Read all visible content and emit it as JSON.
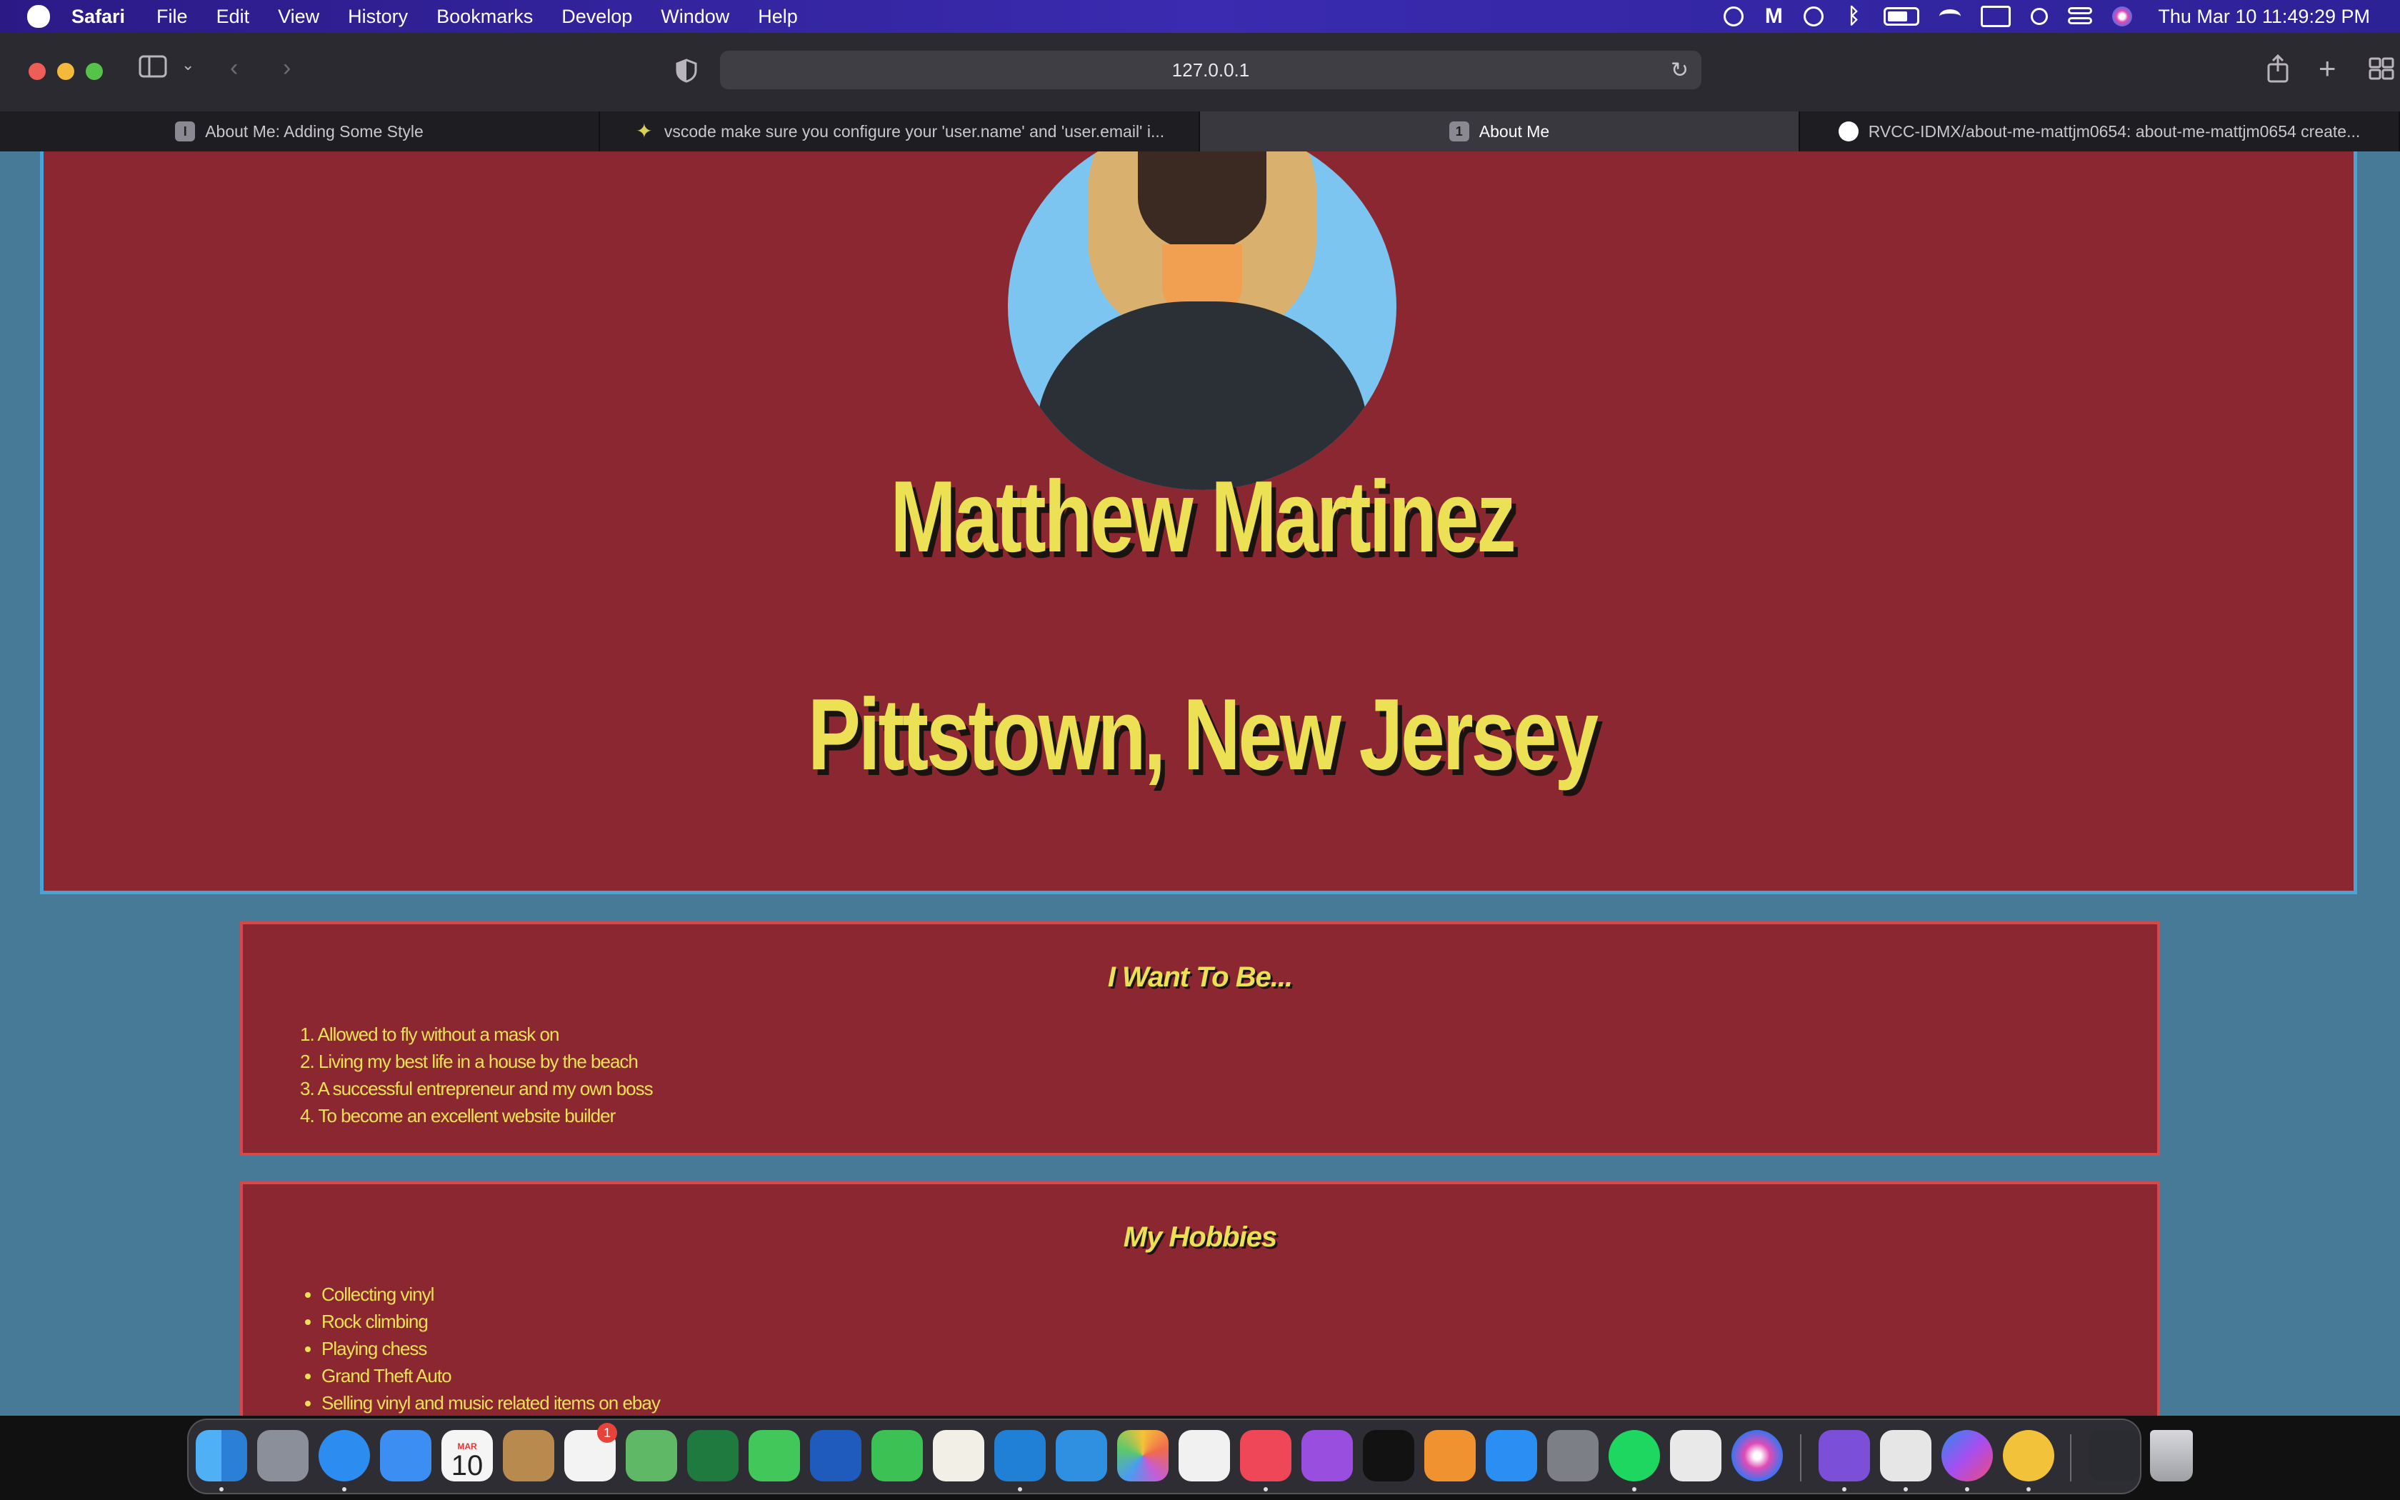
{
  "menubar": {
    "app_name": "Safari",
    "items": [
      "File",
      "Edit",
      "View",
      "History",
      "Bookmarks",
      "Develop",
      "Window",
      "Help"
    ],
    "clock": "Thu Mar 10  11:49:29 PM"
  },
  "toolbar": {
    "url": "127.0.0.1"
  },
  "tabs": [
    {
      "label": "About Me: Adding Some Style",
      "favicon": "I"
    },
    {
      "label": "vscode make sure you configure your 'user.name' and 'user.email' i...",
      "favicon": "wand-icon"
    },
    {
      "label": "About Me",
      "favicon": "1",
      "active": true
    },
    {
      "label": "RVCC-IDMX/about-me-mattjm0654: about-me-mattjm0654 create...",
      "favicon": "github-icon"
    }
  ],
  "page": {
    "name": "Matthew Martinez",
    "city": "Pittstown, New Jersey",
    "want_section": {
      "title": "I Want To Be...",
      "items": [
        "1. Allowed to fly without a mask on",
        "2. Living my best life in a house by the beach",
        "3. A successful entrepreneur and my own boss",
        "4. To become an excellent website builder"
      ]
    },
    "hobbies_section": {
      "title": "My Hobbies",
      "items": [
        "Collecting vinyl",
        "Rock climbing",
        "Playing chess",
        "Grand Theft Auto",
        "Selling vinyl and music related items on ebay"
      ]
    }
  },
  "dock": {
    "calendar_month": "MAR",
    "calendar_day": "10",
    "reminders_badge": "1"
  },
  "colors": {
    "page_background": "#477a96",
    "card_background": "#8a2730",
    "heading_text": "#ece055",
    "card_border": "#d94748",
    "header_border": "#4aa3d8"
  }
}
